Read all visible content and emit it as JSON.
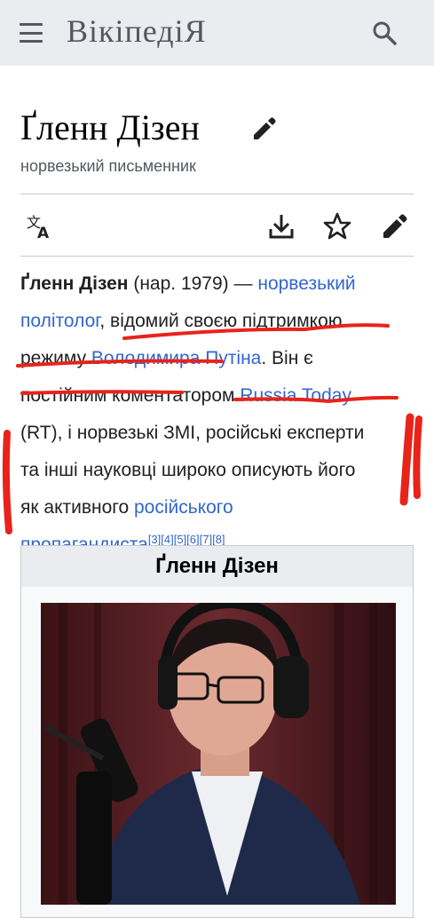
{
  "header": {
    "wordmark": "ВікіпедіЯ",
    "menu_icon": "hamburger-menu-icon",
    "search_icon": "search-icon"
  },
  "page": {
    "title": "Ґленн Дізен",
    "subtitle": "норвезький письменник"
  },
  "toolbar": {
    "language_icon": "translate-icon",
    "download_icon": "download-icon",
    "watch_icon": "star-icon",
    "edit_icon": "pencil-icon"
  },
  "article": {
    "l1_bold": "Ґленн Дізен",
    "l1_text": " (нар. 1979) — ",
    "l1_link": "норвезький",
    "l2_link": "політолог",
    "l2_text": ", відомий своєю підтримкою",
    "l3_text": "режиму ",
    "l3_link": "Володимира Путіна",
    "l3_text2": ". Він є",
    "l4_text": "постійним коментатором ",
    "l4_link": "Russia Today",
    "l5_text": "(RT), і норвезькі ЗМІ, російські експерти",
    "l6_text": "та інші науковці широко описують його",
    "l7_text": "як активного ",
    "l7_link": "російського",
    "l8_link": "пропагандиста",
    "l8_refs": "[3][4][5][6][7][8]",
    "l8_end": "."
  },
  "infobox": {
    "title": "Ґленн Дізен",
    "photo_description": "portrait-photo"
  },
  "colors": {
    "link": "#3366cc",
    "header_bg": "#eaecf0",
    "annotation_red": "#e8231a"
  }
}
